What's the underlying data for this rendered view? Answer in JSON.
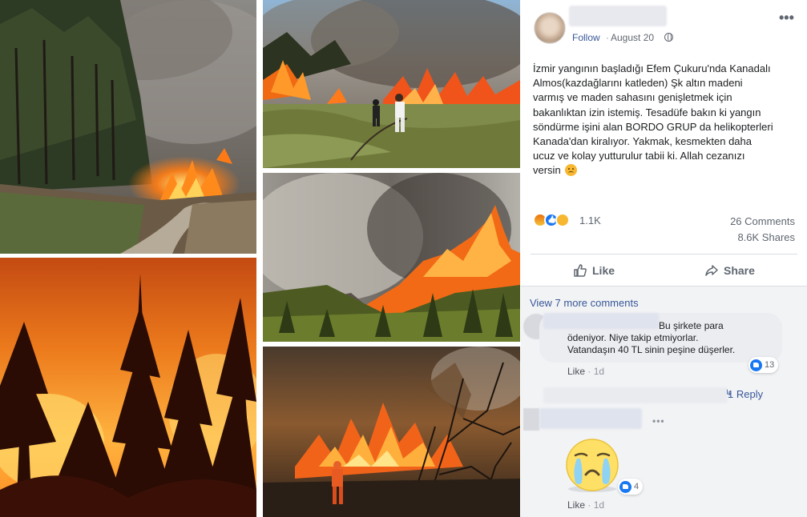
{
  "post": {
    "follow_label": "Follow",
    "separator": "·",
    "date": "August 20",
    "more_label": "•••",
    "text_lines": [
      "İzmir yangının başladığı Efem Çukuru'nda Kanadalı",
      "Almos(kazdağlarını katleden) Şk altın madeni",
      "varmış ve maden sahasını genişletmek için",
      "bakanlıktan izin istemiş. Tesadüfe bakın ki yangın",
      "söndürme işini alan BORDO GRUP da helikopterleri",
      "Kanada'dan kiralıyor. Yakmak, kesmekten daha",
      "ucuz ve kolay yutturulur tabii ki. Allah cezanızı",
      "versin"
    ],
    "reaction_count": "1.1K",
    "comments_count": "26 Comments",
    "shares_count": "8.6K Shares",
    "like_label": "Like",
    "share_label": "Share",
    "reaction_icons": [
      "angry-reaction-icon",
      "like-reaction-icon",
      "sad-reaction-icon"
    ]
  },
  "comments": {
    "view_more_label": "View 7 more comments",
    "items": [
      {
        "text_lines": [
          "Bu şirkete para",
          "ödeniyor. Niye takip etmiyorlar.",
          "Vatandaşın 40 TL sinin peşine düşerler."
        ],
        "reaction_count": "13",
        "like_label": "Like",
        "separator": "·",
        "time": "1d"
      },
      {
        "reply_label": "1 Reply"
      },
      {
        "more_label": "•••",
        "sticker": "crying-face-sticker",
        "reaction_count": "4",
        "like_label": "Like",
        "separator": "·",
        "time": "1d"
      }
    ]
  },
  "colors": {
    "link": "#385898",
    "secondary_text": "#606770",
    "comment_bg": "#f2f3f5",
    "bubble_bg": "#ebedf0",
    "like_blue": "#1877f2"
  }
}
